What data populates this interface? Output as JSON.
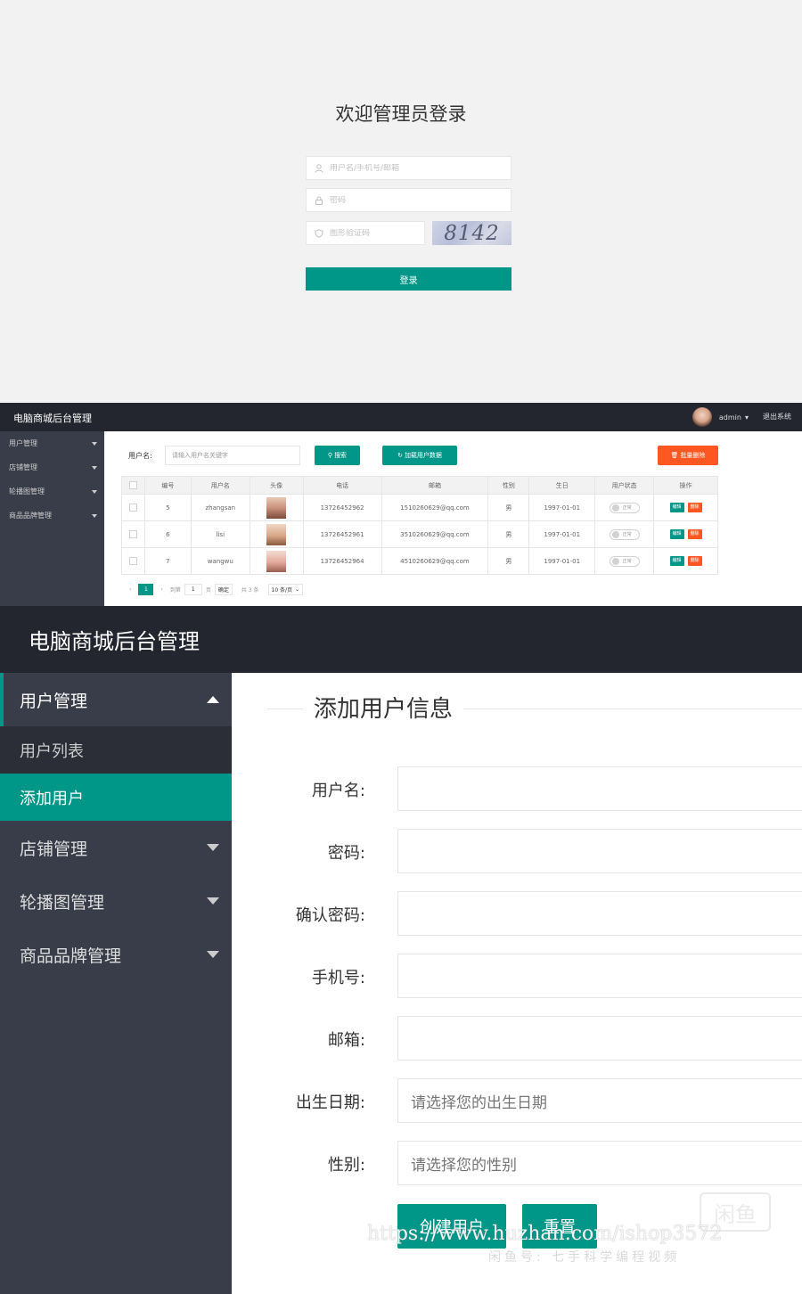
{
  "login": {
    "title": "欢迎管理员登录",
    "username_placeholder": "用户名/手机号/邮箱",
    "password_placeholder": "密码",
    "captcha_placeholder": "图形验证码",
    "captcha_text": "8142",
    "submit_label": "登录"
  },
  "admin_small": {
    "logo": "电脑商城后台管理",
    "user_name": "admin",
    "logout_label": "退出系统",
    "nav": [
      "用户管理",
      "店铺管理",
      "轮播图管理",
      "商品品牌管理"
    ],
    "search_label": "用户名:",
    "search_placeholder": "请输入用户名关键字",
    "search_button": "搜索",
    "reload_button": "加载用户数据",
    "batch_delete_button": "批量删除",
    "table": {
      "headers": [
        "编号",
        "用户名",
        "头像",
        "电话",
        "邮箱",
        "性别",
        "生日",
        "用户状态",
        "操作"
      ],
      "rows": [
        {
          "id": "5",
          "username": "zhangsan",
          "phone": "13726452962",
          "email": "1510260629@qq.com",
          "gender": "男",
          "birthday": "1997-01-01",
          "status": "正常"
        },
        {
          "id": "6",
          "username": "lisi",
          "phone": "13726452961",
          "email": "3510260629@qq.com",
          "gender": "男",
          "birthday": "1997-01-01",
          "status": "正常"
        },
        {
          "id": "7",
          "username": "wangwu",
          "phone": "13726452964",
          "email": "4510260629@qq.com",
          "gender": "男",
          "birthday": "1997-01-01",
          "status": "正常"
        }
      ],
      "edit_label": "编辑",
      "delete_label": "删除"
    },
    "pager": {
      "current_page": "1",
      "goto_label": "到第",
      "goto_value": "1",
      "page_unit": "页",
      "confirm_label": "确定",
      "total_label": "共 3 条",
      "page_size_label": "10 条/页"
    }
  },
  "admin_large": {
    "logo": "电脑商城后台管理",
    "nav": {
      "user_mgmt": "用户管理",
      "user_list": "用户列表",
      "add_user": "添加用户",
      "shop_mgmt": "店铺管理",
      "banner_mgmt": "轮播图管理",
      "brand_mgmt": "商品品牌管理"
    },
    "form_title": "添加用户信息",
    "fields": {
      "username": "用户名:",
      "password": "密码:",
      "confirm_password": "确认密码:",
      "phone": "手机号:",
      "email": "邮箱:",
      "birthday": "出生日期:",
      "gender": "性别:"
    },
    "birthday_placeholder": "请选择您的出生日期",
    "gender_placeholder": "请选择您的性别",
    "create_button": "创建用户",
    "reset_button": "重置"
  },
  "watermark": {
    "url": "https://www.huzhan.com/ishop3572",
    "sub": "闲鱼号: 七手科学编程视频",
    "logo": "闲鱼"
  },
  "colors": {
    "primary": "#009688",
    "danger": "#ff5722",
    "header_bg": "#23262e",
    "sidebar_bg": "#393d49"
  }
}
